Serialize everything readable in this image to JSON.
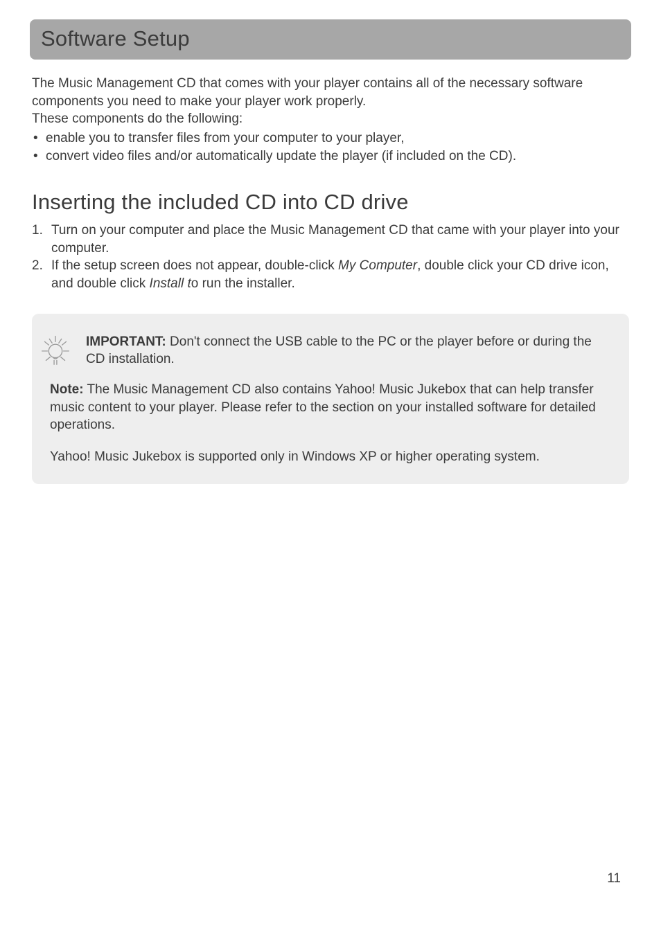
{
  "header": {
    "title": "Software Setup"
  },
  "intro": {
    "p1": "The Music Management CD that comes with your player contains all of the necessary software components you need to make your player work properly.",
    "p2": "These components do the following:",
    "bullets": [
      "enable you to transfer files from your computer to your player,",
      "convert video files and/or automatically update the player (if included on the CD)."
    ]
  },
  "section2": {
    "heading": "Inserting the included CD into CD drive",
    "steps": [
      {
        "pre": "Turn on your computer and place the Music Management CD that came with your player into your computer."
      },
      {
        "pre": "If the setup screen does not appear, double-click ",
        "em1": "My Computer",
        "mid": ", double click your CD drive icon, and double click ",
        "em2": "Install t",
        "post": "o run the installer."
      }
    ]
  },
  "callout": {
    "important_label": "IMPORTANT:",
    "important_text": " Don't connect the USB cable to the PC or the player before or during the CD installation.",
    "note_label": "Note:",
    "note_text": " The Music Management CD also contains Yahoo! Music Jukebox that can help transfer music content to your player. Please refer to the section on your installed software for detailed operations.",
    "jukebox_text": "Yahoo! Music Jukebox is supported only in Windows XP or higher operating system."
  },
  "page_number": "11"
}
